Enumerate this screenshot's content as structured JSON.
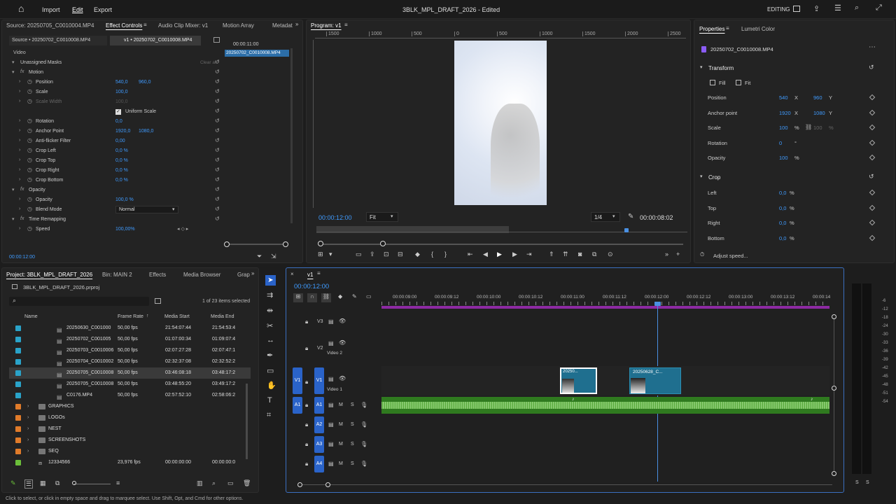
{
  "topbar": {
    "home": "⌂",
    "menu": [
      "Import",
      "Edit",
      "Export"
    ],
    "title": "3BLK_MPL_DRAFT_2026 - Edited",
    "workspace": "EDITING"
  },
  "source_tabs": [
    "Source: 20250705_C0010004.MP4",
    "Effect Controls",
    "Audio Clip Mixer: v1",
    "Motion Array",
    "Metadat"
  ],
  "effect_controls": {
    "subtab_source": "Source • 20250702_C0010008.MP4",
    "subtab_seq": "v1 • 20250702_C0010008.MP4",
    "mini_time": "00:00:11:00",
    "mini_clip": "20250702_C0010008.MP4",
    "section": "Video",
    "clear": "Clear all",
    "rows": [
      {
        "label": "Unassigned Masks",
        "indent": 0,
        "v1": "",
        "v2": ""
      },
      {
        "label": "Motion",
        "indent": 1,
        "v1": "",
        "v2": "",
        "fx": true
      },
      {
        "label": "Position",
        "indent": 2,
        "v1": "540,0",
        "v2": "960,0"
      },
      {
        "label": "Scale",
        "indent": 2,
        "v1": "100,0",
        "v2": ""
      },
      {
        "label": "Scale Width",
        "indent": 2,
        "v1": "100,0",
        "v2": "",
        "dim": true
      },
      {
        "label": "Uniform Scale",
        "indent": 3,
        "v1": "",
        "v2": "",
        "check": true
      },
      {
        "label": "Rotation",
        "indent": 2,
        "v1": "0,0",
        "v2": ""
      },
      {
        "label": "Anchor Point",
        "indent": 2,
        "v1": "1920,0",
        "v2": "1080,0"
      },
      {
        "label": "Anti-flicker Filter",
        "indent": 2,
        "v1": "0,00",
        "v2": ""
      },
      {
        "label": "Crop Left",
        "indent": 2,
        "v1": "0,0 %",
        "v2": ""
      },
      {
        "label": "Crop Top",
        "indent": 2,
        "v1": "0,0 %",
        "v2": ""
      },
      {
        "label": "Crop Right",
        "indent": 2,
        "v1": "0,0 %",
        "v2": ""
      },
      {
        "label": "Crop Bottom",
        "indent": 2,
        "v1": "0,0 %",
        "v2": ""
      },
      {
        "label": "Opacity",
        "indent": 1,
        "v1": "",
        "v2": "",
        "fx": true
      },
      {
        "label": "Opacity",
        "indent": 2,
        "v1": "100,0 %",
        "v2": ""
      },
      {
        "label": "Blend Mode",
        "indent": 2,
        "v1": "Normal",
        "v2": "",
        "select": true
      },
      {
        "label": "Time Remapping",
        "indent": 1,
        "v1": "",
        "v2": "",
        "fx": true
      },
      {
        "label": "Speed",
        "indent": 2,
        "v1": "100,00%",
        "v2": ""
      }
    ],
    "timecode": "00:00:12:00"
  },
  "program": {
    "tab": "Program: v1",
    "ruler": [
      "1500",
      "1000",
      "500",
      "0",
      "500",
      "1000",
      "1500",
      "2000",
      "2500"
    ],
    "timecode": "00:00:12:00",
    "fit": "Fit",
    "quality": "1/4",
    "duration": "00:00:08:02"
  },
  "properties": {
    "tabs": [
      "Properties",
      "Lumetri Color"
    ],
    "clip": "20250702_C0010008.MP4",
    "transform": "Transform",
    "fill": "Fill",
    "fit": "Fit",
    "rows": [
      {
        "label": "Position",
        "v1": "540",
        "u1": "X",
        "v2": "960",
        "u2": "Y"
      },
      {
        "label": "Anchor point",
        "v1": "1920",
        "u1": "X",
        "v2": "1080",
        "u2": "Y"
      },
      {
        "label": "Scale",
        "v1": "100",
        "u1": "%",
        "v2": "100",
        "u2": "%"
      },
      {
        "label": "Rotation",
        "v1": "0",
        "u1": "°",
        "v2": "",
        "u2": ""
      },
      {
        "label": "Opacity",
        "v1": "100",
        "u1": "%",
        "v2": "",
        "u2": ""
      }
    ],
    "crop": "Crop",
    "crop_rows": [
      {
        "label": "Left",
        "v": "0,0",
        "u": "%"
      },
      {
        "label": "Top",
        "v": "0,0",
        "u": "%"
      },
      {
        "label": "Right",
        "v": "0,0",
        "u": "%"
      },
      {
        "label": "Bottom",
        "v": "0,0",
        "u": "%"
      }
    ],
    "adjust_speed": "Adjust speed..."
  },
  "project": {
    "tabs": [
      "Project: 3BLK_MPL_DRAFT_2026",
      "Bin: MAIN 2",
      "Effects",
      "Media Browser",
      "Grap"
    ],
    "file": "3BLK_MPL_DRAFT_2026.prproj",
    "count": "1 of 23 items selected",
    "cols": [
      "Name",
      "Frame Rate",
      "Media Start",
      "Media End"
    ],
    "items": [
      {
        "name": "20250630_C001000",
        "fps": "50,00 fps",
        "start": "21:54:07:44",
        "end": "21:54:53:4",
        "color": "#2aa3c9",
        "type": "clip"
      },
      {
        "name": "20250702_C001005",
        "fps": "50,00 fps",
        "start": "01:07:00:34",
        "end": "01:09:07:4",
        "color": "#2aa3c9",
        "type": "clip"
      },
      {
        "name": "20250703_C0010006",
        "fps": "50,00 fps",
        "start": "02:07:27:28",
        "end": "02:07:47:1",
        "color": "#2aa3c9",
        "type": "clip"
      },
      {
        "name": "20250704_C0010002",
        "fps": "50,00 fps",
        "start": "02:32:37:08",
        "end": "02:32:52:2",
        "color": "#2aa3c9",
        "type": "clip"
      },
      {
        "name": "20250705_C0010008",
        "fps": "50,00 fps",
        "start": "03:46:08:18",
        "end": "03:48:17:2",
        "color": "#2aa3c9",
        "type": "clip",
        "selected": true
      },
      {
        "name": "20250705_C0010008",
        "fps": "50,00 fps",
        "start": "03:48:55:20",
        "end": "03:49:17:2",
        "color": "#2aa3c9",
        "type": "clip"
      },
      {
        "name": "C0176.MP4",
        "fps": "50,00 fps",
        "start": "02:57:52:10",
        "end": "02:58:06:2",
        "color": "#2aa3c9",
        "type": "clip"
      },
      {
        "name": "GRAPHICS",
        "fps": "",
        "start": "",
        "end": "",
        "color": "#e07b2a",
        "type": "folder"
      },
      {
        "name": "LOGOs",
        "fps": "",
        "start": "",
        "end": "",
        "color": "#e07b2a",
        "type": "folder"
      },
      {
        "name": "NEST",
        "fps": "",
        "start": "",
        "end": "",
        "color": "#e07b2a",
        "type": "folder"
      },
      {
        "name": "SCREENSHOTS",
        "fps": "",
        "start": "",
        "end": "",
        "color": "#e07b2a",
        "type": "folder"
      },
      {
        "name": "SEQ",
        "fps": "",
        "start": "",
        "end": "",
        "color": "#e07b2a",
        "type": "folder"
      },
      {
        "name": "12334566",
        "fps": "23,976 fps",
        "start": "00:00:00:00",
        "end": "00:00:00:0",
        "color": "#6bbf3a",
        "type": "seq"
      }
    ]
  },
  "timeline": {
    "tab": "v1",
    "timecode": "00:00:12:00",
    "ruler": [
      "00:00:09:00",
      "00:00:09:12",
      "00:00:10:00",
      "00:00:10:12",
      "00:00:11:00",
      "00:00:11:12",
      "00:00:12:00",
      "00:00:12:12",
      "00:00:13:00",
      "00:00:13:12",
      "00:00:14"
    ],
    "tracks": {
      "v3": "V3",
      "v2": "V2",
      "v2name": "Video 2",
      "v1": "V1",
      "v1name": "Video 1",
      "a1": "A1",
      "a2": "A2",
      "a3": "A3",
      "a4": "A4"
    },
    "clip1": "20250...",
    "clip2": "20250628_C..."
  },
  "meter": {
    "labels": [
      "-6",
      "-12",
      "-18",
      "-24",
      "-30",
      "-33",
      "-36",
      "-39",
      "-42",
      "-45",
      "-48",
      "-51",
      "-54"
    ],
    "solo": "S"
  },
  "status": "Click to select, or click in empty space and drag to marquee select. Use Shift, Opt, and Cmd for other options.",
  "colors": {
    "accent": "#3f9bff",
    "audio": "#2f7a1f",
    "video": "#1f6f8f",
    "playhead": "#4a90e2",
    "workarea": "#8d2aa3"
  }
}
